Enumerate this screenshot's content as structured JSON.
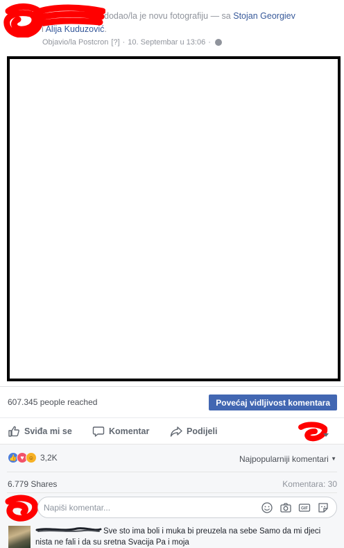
{
  "post": {
    "action_text": "dodao/la je novu fotografiju — sa",
    "tagged_1": "Stojan Georgiev",
    "and_word": "i",
    "tagged_2": "Alija Kuduzović",
    "period": ".",
    "published_via": "Objavio/la Postcron",
    "help_marker": "[?]",
    "sep1": "·",
    "date": "10. Septembar u 13:06",
    "sep2": "·",
    "privacy_icon": "globe-icon"
  },
  "stats": {
    "reached": "607.345 people reached",
    "boost_label": "Povećaj vidljivost komentara"
  },
  "actions": {
    "like": "Sviđa mi se",
    "comment": "Komentar",
    "share": "Podijeli"
  },
  "feedback": {
    "reaction_count": "3,2K",
    "reactions": [
      "like",
      "love",
      "haha"
    ],
    "sort_label": "Najpopularniji komentari",
    "shares": "6.779 Shares",
    "comments_count": "Komentara: 30",
    "comment_placeholder": "Napiši komentar..."
  },
  "comment": {
    "text": "Sve sto ima boli i muka bi preuzela na sebe Samo da mi djeci nista ne fali i da su sretna Svacija Pa i moja"
  },
  "colors": {
    "link": "#365899",
    "button": "#4267b2",
    "redaction": "#ff0000"
  }
}
